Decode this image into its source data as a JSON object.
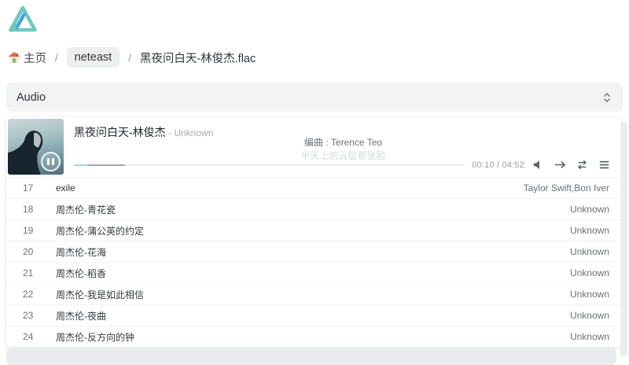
{
  "brand": {
    "logo_name": "alist-logo",
    "color_teal": "#6bc9c0",
    "color_blue": "#4d9fdb"
  },
  "breadcrumb": {
    "home": "主页",
    "separator": "/",
    "folder": "neteast",
    "file": "黑夜问白天-林俊杰.flac"
  },
  "type_selector": {
    "value": "Audio"
  },
  "player": {
    "song_title": "黑夜问白天-林俊杰",
    "song_artist": " - Unknown",
    "lyric_line_current": "编曲 : Terence Teo",
    "lyric_line_next": "半天上的云层那张脸",
    "time": "00:10 / 04:52",
    "progress": {
      "played_percent": 3.4,
      "loaded_percent": 13
    },
    "control_icons": [
      "volume-icon",
      "play-order-icon",
      "loop-icon",
      "playlist-menu-icon"
    ],
    "state": "paused-button-shows-pause-glyph"
  },
  "playlist": {
    "rows": [
      {
        "index": "17",
        "title": "exile",
        "artist": "Taylor Swift,Bon Iver"
      },
      {
        "index": "18",
        "title": "周杰伦-青花瓷",
        "artist": "Unknown"
      },
      {
        "index": "19",
        "title": "周杰伦-蒲公英的约定",
        "artist": "Unknown"
      },
      {
        "index": "20",
        "title": "周杰伦-花海",
        "artist": "Unknown"
      },
      {
        "index": "21",
        "title": "周杰伦-稻香",
        "artist": "Unknown"
      },
      {
        "index": "22",
        "title": "周杰伦-我是如此相信",
        "artist": "Unknown"
      },
      {
        "index": "23",
        "title": "周杰伦-夜曲",
        "artist": "Unknown"
      },
      {
        "index": "24",
        "title": "周杰伦-反方向的钟",
        "artist": "Unknown"
      }
    ]
  },
  "colors": {
    "select_bg": "#f1f3f5",
    "pill_bg": "#eceef0",
    "progress_played": "#a8d0f5",
    "progress_loaded": "#a3a6a9",
    "row_border": "#f1f1f1"
  }
}
